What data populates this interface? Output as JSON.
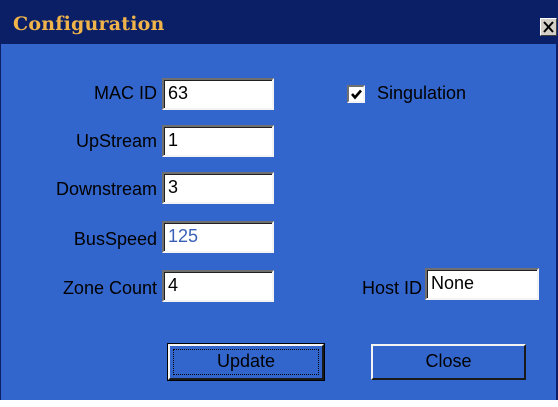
{
  "window": {
    "title": "Configuration",
    "close_icon": "close-icon",
    "colors": {
      "title_bar": "#0a1f66",
      "title_text": "#f0b44a",
      "dialog_bg": "#3366cc",
      "disabled_value": "#3a5fb8"
    }
  },
  "fields": {
    "mac_id": {
      "label": "MAC ID",
      "value": "63"
    },
    "upstream": {
      "label": "UpStream",
      "value": "1"
    },
    "downstream": {
      "label": "Downstream",
      "value": "3"
    },
    "busspeed": {
      "label": "BusSpeed",
      "value": "125"
    },
    "zone_count": {
      "label": "Zone Count",
      "value": "4"
    },
    "host_id": {
      "label": "Host ID",
      "value": "None"
    }
  },
  "singulation": {
    "label": "Singulation",
    "checked": true,
    "icon": "checkmark-icon"
  },
  "buttons": {
    "update": "Update",
    "close": "Close"
  }
}
